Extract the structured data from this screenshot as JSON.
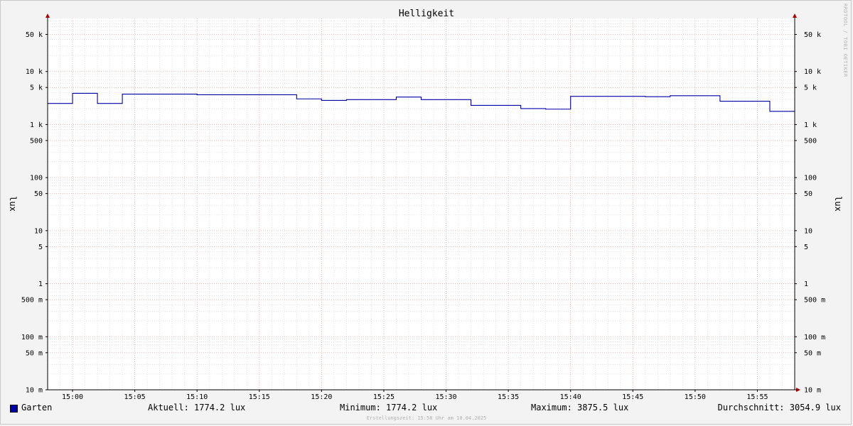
{
  "chart_data": {
    "type": "line",
    "title": "Helligkeit",
    "ylabel": "lux",
    "y_scale": "log",
    "ylim": [
      0.01,
      100000
    ],
    "xlim": [
      "14:58",
      "15:58"
    ],
    "x_tick_labels": [
      "15:00",
      "15:05",
      "15:10",
      "15:15",
      "15:20",
      "15:25",
      "15:30",
      "15:35",
      "15:40",
      "15:45",
      "15:50",
      "15:55"
    ],
    "y_tick_labels": [
      {
        "value": 50000,
        "label": "50 k"
      },
      {
        "value": 10000,
        "label": "10 k"
      },
      {
        "value": 5000,
        "label": "5 k"
      },
      {
        "value": 1000,
        "label": "1 k"
      },
      {
        "value": 500,
        "label": "500"
      },
      {
        "value": 100,
        "label": "100"
      },
      {
        "value": 50,
        "label": "50"
      },
      {
        "value": 10,
        "label": "10"
      },
      {
        "value": 5,
        "label": "5"
      },
      {
        "value": 1,
        "label": "1"
      },
      {
        "value": 0.5,
        "label": "500 m"
      },
      {
        "value": 0.1,
        "label": "100 m"
      },
      {
        "value": 0.05,
        "label": "50 m"
      },
      {
        "value": 0.01,
        "label": "10 m"
      }
    ],
    "grid": true,
    "series": [
      {
        "name": "Garten",
        "color": "#0000aa",
        "points": [
          [
            "14:58",
            2500
          ],
          [
            "15:00",
            3875.5
          ],
          [
            "15:02",
            2500
          ],
          [
            "15:04",
            3750
          ],
          [
            "15:10",
            3650
          ],
          [
            "15:18",
            3050
          ],
          [
            "15:20",
            2850
          ],
          [
            "15:22",
            2950
          ],
          [
            "15:26",
            3300
          ],
          [
            "15:28",
            2950
          ],
          [
            "15:32",
            2300
          ],
          [
            "15:36",
            2000
          ],
          [
            "15:38",
            1950
          ],
          [
            "15:40",
            3400
          ],
          [
            "15:46",
            3350
          ],
          [
            "15:48",
            3500
          ],
          [
            "15:52",
            2750
          ],
          [
            "15:56",
            1774.2
          ],
          [
            "15:58",
            1774.2
          ]
        ]
      }
    ]
  },
  "legend": {
    "series_name": "Garten",
    "aktuell": "Aktuell: 1774.2 lux",
    "minimum": "Minimum: 1774.2 lux",
    "maximum": "Maximum: 3875.5 lux",
    "durchschnitt": "Durchschnitt: 3054.9 lux"
  },
  "watermark": "RRDTOOL / TOBI OETIKER",
  "footer": "Erstellungszeit: 15:58 Uhr am 10.04.2025",
  "colors": {
    "grid_major": "#e8a3a3",
    "grid_minor": "#cfcfcf",
    "line": "#0000aa",
    "axis_arrow": "#aa0000"
  }
}
